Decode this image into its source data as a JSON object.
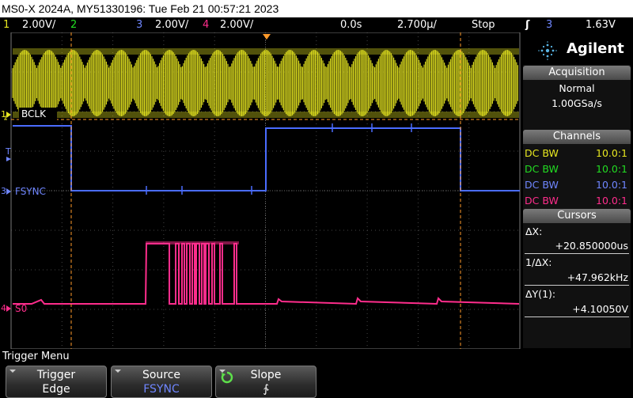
{
  "titlebar": {
    "text": "MS0-X 2024A, MY51330196: Tue Feb 21 00:57:21 2023"
  },
  "status": {
    "ch1_num": "1",
    "ch1_scale": "2.00V/",
    "ch2_num": "2",
    "ch3_num": "3",
    "ch3_scale": "2.00V/",
    "ch4_num": "4",
    "ch4_scale": "2.00V/",
    "delay": "0.0s",
    "timebase": "2.700µ/",
    "run_state": "Stop",
    "trigger_icon": "trigger-rising-edge-icon",
    "trigger_source": "3",
    "trigger_level": "1.63V"
  },
  "traces": {
    "ch1_label": "BCLK",
    "ch3_label": "FSYNC",
    "ch4_label": "S0",
    "ch1_marker": "1",
    "ch3_marker": "3",
    "ch4_marker": "4",
    "trigger_marker": "T"
  },
  "panel": {
    "brand": "Agilent",
    "acquisition": {
      "header": "Acquisition",
      "mode": "Normal",
      "rate": "1.00GSa/s"
    },
    "channels": {
      "header": "Channels",
      "rows": [
        {
          "coupling": "DC BW",
          "probe": "10.0:1",
          "color": "#e8e820"
        },
        {
          "coupling": "DC BW",
          "probe": "10.0:1",
          "color": "#22dd22"
        },
        {
          "coupling": "DC BW",
          "probe": "10.0:1",
          "color": "#6f86ff"
        },
        {
          "coupling": "DC BW",
          "probe": "10.0:1",
          "color": "#ff2d8c"
        }
      ]
    },
    "cursors": {
      "header": "Cursors",
      "dx_label": "ΔX:",
      "dx_value": "+20.850000us",
      "inv_dx_label": "1/ΔX:",
      "inv_dx_value": "+47.962kHz",
      "dy_label": "ΔY(1):",
      "dy_value": "+4.10050V"
    }
  },
  "menu": {
    "title": "Trigger Menu",
    "softkeys": [
      {
        "top": "Trigger",
        "bottom": "Edge",
        "bottom_color": "#ffffff"
      },
      {
        "top": "Source",
        "bottom": "FSYNC",
        "bottom_color": "#6f86ff"
      },
      {
        "top": "Slope",
        "bottom": "∱",
        "bottom_color": "#ffffff"
      }
    ]
  },
  "colors": {
    "ch1": "#e8e820",
    "ch2": "#22dd22",
    "ch3": "#4a6cff",
    "ch4": "#ff2d8c",
    "cursor": "#ff9a2a",
    "grid": "#555555"
  }
}
